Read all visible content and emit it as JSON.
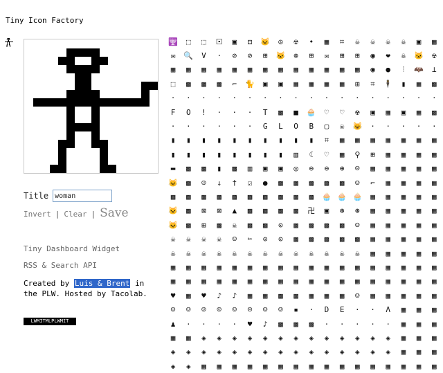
{
  "app_title": "Tiny Icon Factory",
  "editor": {
    "bitmap": [
      "0000000000000000",
      "0000011110000000",
      "0000110011000000",
      "0000011110000000",
      "0000001100000000",
      "0000001100000011",
      "0000011110000010",
      "0111111111111110",
      "0000010010000000",
      "0000010010000000",
      "0000011110000000",
      "0000010010000000",
      "0000110011000000",
      "0000100001000000",
      "0000100001000000",
      "0001100001100000"
    ]
  },
  "title_label": "Title",
  "title_value": "woman",
  "actions": {
    "invert": "Invert",
    "clear": "Clear",
    "save": "Save",
    "separator": "|"
  },
  "links": {
    "dashboard": "Tiny Dashboard Widget",
    "rss": "RSS & Search API"
  },
  "credits": {
    "prefix": "Created by ",
    "authors": "Luis & Brent",
    "suffix": " in the PLW. Hosted by Tacolab."
  },
  "badge_text": "LWMITMLPLWMIT",
  "icon_grid": {
    "rows": [
      [
        "🕎",
        "⬚",
        "⬚",
        "🞔",
        "▣",
        "⚃",
        "🐱",
        "☮",
        "☢",
        "•",
        "▦",
        "⌗",
        "☠",
        "☠",
        "☠",
        "☠",
        "▣",
        "▦"
      ],
      [
        "✉",
        "🔍",
        "V",
        "·",
        "⊘",
        "⊘",
        "⊞",
        "🐱",
        "⊗",
        "⊞",
        "✉",
        "⊞",
        "⊞",
        "◉",
        "❤",
        "☠",
        "🐱",
        "☢"
      ],
      [
        "▦",
        "▦",
        "▦",
        "▦",
        "▦",
        "▦",
        "▦",
        "▦",
        "▦",
        "▦",
        "▦",
        "▦",
        "▦",
        "◉",
        "●",
        "⫶",
        "🦇",
        "⊥"
      ],
      [
        "⬚",
        "▩",
        "▩",
        "▩",
        "⌐",
        "🐈",
        "▣",
        "▣",
        "▦",
        "▦",
        "▦",
        "▦",
        "⊞",
        "⌗",
        "🕴",
        "▮",
        "▦",
        "▩"
      ],
      [
        "·",
        "·",
        "·",
        "·",
        "·",
        "·",
        "·",
        "·",
        "·",
        "·",
        "·",
        "·",
        "·",
        "·",
        "·",
        "·",
        "·",
        "·"
      ],
      [
        "F",
        "O",
        "!",
        "·",
        "·",
        "·",
        "T",
        "▩",
        "■",
        "🧁",
        "♡",
        "♡",
        "☢",
        "▣",
        "▦",
        "▣",
        "▦",
        "▩"
      ],
      [
        "·",
        "·",
        "·",
        "·",
        "·",
        "·",
        "G",
        "L",
        "O",
        "B",
        "▢",
        "☠",
        "😺",
        "·",
        "·",
        "·",
        "·",
        "·"
      ],
      [
        "▮",
        "▮",
        "▮",
        "▮",
        "▮",
        "▮",
        "▮",
        "▮",
        "▮",
        "▮",
        "⌗",
        "▦",
        "▦",
        "▦",
        "▦",
        "▦",
        "▦",
        "▦"
      ],
      [
        "▮",
        "▮",
        "▮",
        "▮",
        "▮",
        "▮",
        "▮",
        "▮",
        "▥",
        "☾",
        "♡",
        "▦",
        "⚲",
        "⊞",
        "▦",
        "▦",
        "▦",
        "▦"
      ],
      [
        "▬",
        "▩",
        "▩",
        "▮",
        "▩",
        "▥",
        "▣",
        "▣",
        "◎",
        "⊖",
        "⊖",
        "⊕",
        "☹",
        "▦",
        "▦",
        "▦",
        "▦",
        "▦"
      ],
      [
        "🐱",
        "▩",
        "☹",
        "↓",
        "†",
        "☑",
        "●",
        "▩",
        "▩",
        "▩",
        "▩",
        "▩",
        "☺",
        "⌐",
        "▦",
        "▦",
        "▦",
        "▦"
      ],
      [
        "▩",
        "▩",
        "▩",
        "▩",
        "▩",
        "▩",
        "▩",
        "▩",
        "▩",
        "▩",
        "🧁",
        "🧁",
        "🧁",
        "▦",
        "▦",
        "▦",
        "▦",
        "▦"
      ],
      [
        "🐱",
        "▩",
        "⊠",
        "⊠",
        "▲",
        "▩",
        "▩",
        "▩",
        "▩",
        "卍",
        "▣",
        "⊛",
        "⊛",
        "▦",
        "▦",
        "▦",
        "▦",
        "▦"
      ],
      [
        "🐱",
        "▩",
        "⊞",
        "▩",
        "☠",
        "▩",
        "▩",
        "⊙",
        "▩",
        "▩",
        "▩",
        "▩",
        "☺",
        "▦",
        "▦",
        "▦",
        "▦",
        "▦"
      ],
      [
        "☠",
        "☠",
        "☠",
        "☠",
        "☺",
        "✂",
        "⊙",
        "⊙",
        "▩",
        "▩",
        "▩",
        "▩",
        "▩",
        "▦",
        "▦",
        "▦",
        "▦",
        "▦"
      ],
      [
        "☠",
        "☠",
        "☠",
        "☠",
        "☠",
        "☠",
        "☠",
        "☠",
        "☠",
        "☠",
        "☠",
        "☠",
        "☠",
        "▦",
        "▦",
        "▦",
        "▦",
        "▦"
      ],
      [
        "▦",
        "▦",
        "▦",
        "▦",
        "▦",
        "▦",
        "▦",
        "▦",
        "▦",
        "▦",
        "▦",
        "▦",
        "▦",
        "▦",
        "▦",
        "▦",
        "▦",
        "▦"
      ],
      [
        "▦",
        "▦",
        "▦",
        "▦",
        "▦",
        "▦",
        "▦",
        "▦",
        "▦",
        "▦",
        "▦",
        "▦",
        "▦",
        "▦",
        "▦",
        "▦",
        "▦",
        "▦"
      ],
      [
        "♥",
        "▦",
        "♥",
        "♪",
        "♪",
        "▦",
        "▦",
        "▩",
        "▩",
        "▦",
        "▦",
        "▦",
        "☺",
        "▦",
        "▦",
        "▦",
        "▦",
        "▦"
      ],
      [
        "☺",
        "☺",
        "☺",
        "☺",
        "☺",
        "☹",
        "☺",
        "☺",
        "▪",
        "·",
        "D",
        "E",
        "·",
        "·",
        "Λ",
        "▦",
        "▦",
        "▦"
      ],
      [
        "♟",
        "·",
        "·",
        "·",
        "·",
        "♥",
        "♪",
        "▩",
        "▩",
        "▩",
        "·",
        "·",
        "·",
        "·",
        "·",
        "▦",
        "▦",
        "▦"
      ],
      [
        "▦",
        "▦",
        "◈",
        "◈",
        "◈",
        "◈",
        "◈",
        "◈",
        "◈",
        "◈",
        "◈",
        "◈",
        "◈",
        "◈",
        "◈",
        "▦",
        "▦",
        "▦"
      ],
      [
        "◈",
        "◈",
        "◈",
        "◈",
        "◈",
        "◈",
        "◈",
        "◈",
        "◈",
        "◈",
        "◈",
        "◈",
        "◈",
        "◈",
        "◈",
        "▦",
        "▦",
        "▦"
      ],
      [
        "◈",
        "◈",
        "▦",
        "▦",
        "▦",
        "▦",
        "▦",
        "▦",
        "▦",
        "▦",
        "▦",
        "▦",
        "▦",
        "▦",
        "▦",
        "▦",
        "▦",
        "▦"
      ]
    ]
  }
}
